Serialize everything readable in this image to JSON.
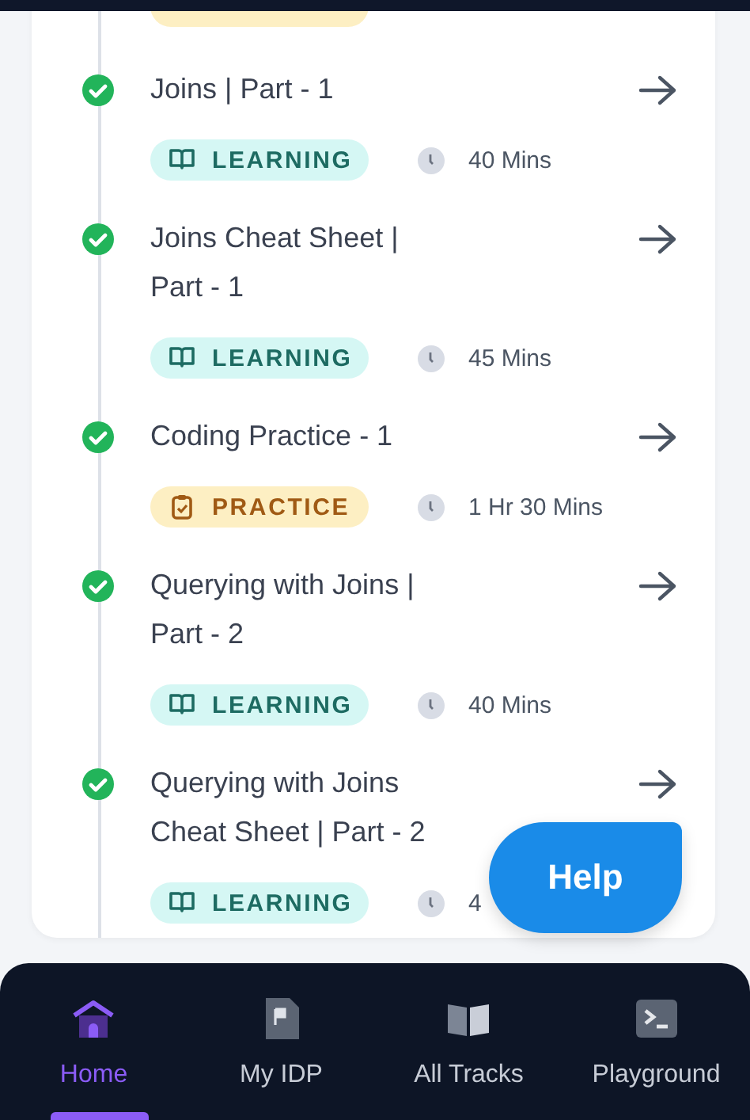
{
  "partial_tag": {
    "kind": "practice"
  },
  "items": [
    {
      "title": "Joins | Part - 1",
      "completed": true,
      "tag": {
        "kind": "learning",
        "label": "LEARNING"
      },
      "duration": "40 Mins"
    },
    {
      "title": "Joins Cheat Sheet | Part - 1",
      "completed": true,
      "tag": {
        "kind": "learning",
        "label": "LEARNING"
      },
      "duration": "45 Mins"
    },
    {
      "title": "Coding Practice - 1",
      "completed": true,
      "tag": {
        "kind": "practice",
        "label": "PRACTICE"
      },
      "duration": "1 Hr 30 Mins"
    },
    {
      "title": "Querying with Joins | Part - 2",
      "completed": true,
      "tag": {
        "kind": "learning",
        "label": "LEARNING"
      },
      "duration": "40 Mins"
    },
    {
      "title": "Querying with Joins Cheat Sheet | Part - 2",
      "completed": true,
      "tag": {
        "kind": "learning",
        "label": "LEARNING"
      },
      "duration": "4"
    }
  ],
  "help_button": {
    "label": "Help"
  },
  "nav": [
    {
      "kind": "home",
      "label": "Home",
      "selected": true
    },
    {
      "kind": "idp",
      "label": "My IDP",
      "selected": false
    },
    {
      "kind": "tracks",
      "label": "All Tracks",
      "selected": false
    },
    {
      "kind": "playground",
      "label": "Playground",
      "selected": false
    }
  ]
}
